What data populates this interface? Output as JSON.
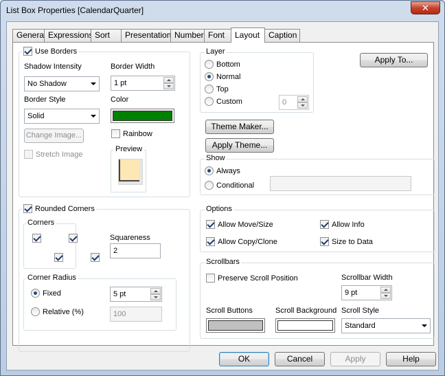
{
  "window": {
    "title": "List Box Properties [CalendarQuarter]"
  },
  "tabs": [
    "General",
    "Expressions",
    "Sort",
    "Presentation",
    "Number",
    "Font",
    "Layout",
    "Caption"
  ],
  "borders": {
    "use_borders_label": "Use Borders",
    "shadow_intensity_label": "Shadow Intensity",
    "shadow_intensity_value": "No Shadow",
    "border_width_label": "Border Width",
    "border_width_value": "1 pt",
    "border_style_label": "Border Style",
    "border_style_value": "Solid",
    "color_label": "Color",
    "color_value": "#008000",
    "rainbow_label": "Rainbow",
    "change_image_label": "Change Image...",
    "stretch_image_label": "Stretch Image",
    "preview_label": "Preview"
  },
  "layer": {
    "label": "Layer",
    "options": [
      "Bottom",
      "Normal",
      "Top",
      "Custom"
    ],
    "selected": "Normal",
    "custom_value": "0"
  },
  "apply_to_label": "Apply To...",
  "theme_maker_label": "Theme Maker...",
  "apply_theme_label": "Apply Theme...",
  "show": {
    "label": "Show",
    "always_label": "Always",
    "conditional_label": "Conditional"
  },
  "rounded": {
    "rounded_corners_label": "Rounded Corners",
    "corners_label": "Corners",
    "squareness_label": "Squareness",
    "squareness_value": "2",
    "corner_radius_label": "Corner Radius",
    "fixed_label": "Fixed",
    "fixed_value": "5 pt",
    "relative_label": "Relative (%)",
    "relative_value": "100"
  },
  "options": {
    "label": "Options",
    "allow_move_size": "Allow Move/Size",
    "allow_info": "Allow Info",
    "allow_copy_clone": "Allow Copy/Clone",
    "size_to_data": "Size to Data"
  },
  "scrollbars": {
    "label": "Scrollbars",
    "preserve_label": "Preserve Scroll Position",
    "width_label": "Scrollbar Width",
    "width_value": "9 pt",
    "scroll_buttons_label": "Scroll Buttons",
    "scroll_buttons_color": "#c0c0c0",
    "scroll_background_label": "Scroll Background",
    "scroll_background_color": "#ffffff",
    "scroll_style_label": "Scroll Style",
    "scroll_style_value": "Standard"
  },
  "dialog_buttons": {
    "ok": "OK",
    "cancel": "Cancel",
    "apply": "Apply",
    "help": "Help"
  },
  "icons": {
    "close": "close-icon"
  }
}
